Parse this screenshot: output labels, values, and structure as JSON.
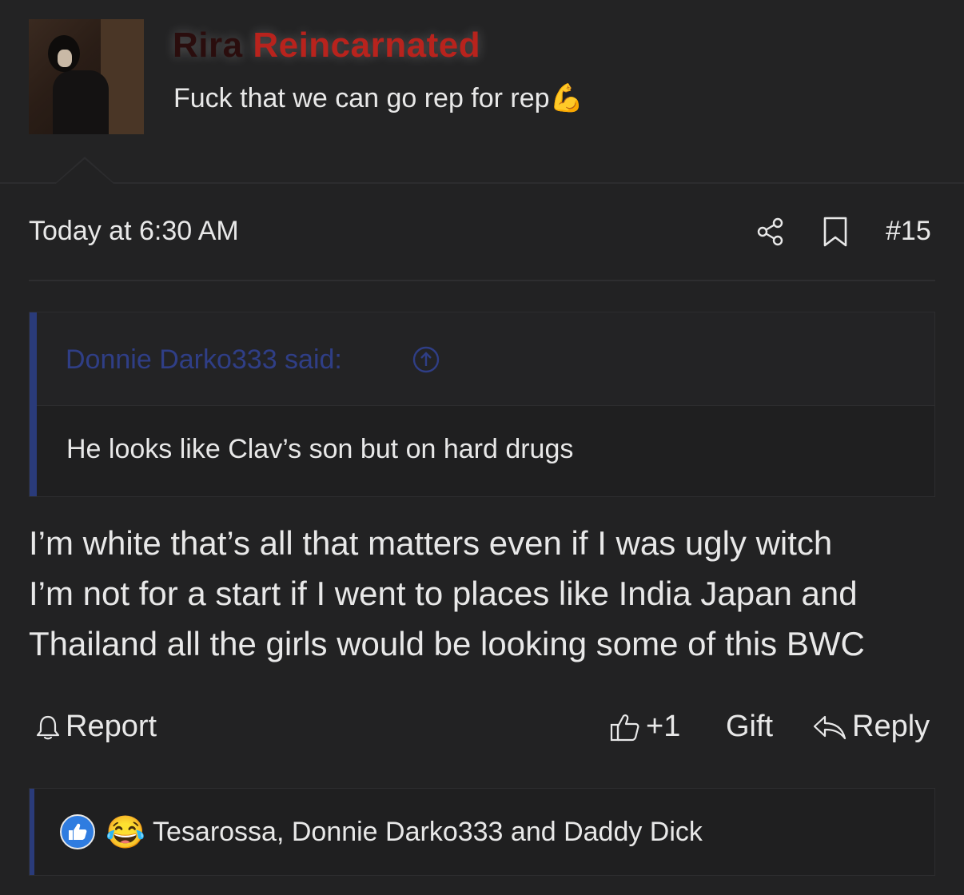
{
  "author": {
    "name_part1": "Rira",
    "name_part2": "Reincarnated",
    "custom_title": "Fuck that we can go rep for rep",
    "title_emoji": "💪"
  },
  "meta": {
    "timestamp": "Today at 6:30 AM",
    "post_number": "#15",
    "share_icon": "share-icon",
    "bookmark_icon": "bookmark-icon"
  },
  "quote": {
    "author_label": "Donnie Darko333 said:",
    "text": "He looks like Clav’s son but on hard drugs",
    "bar_color": "#2a3b7a",
    "author_color": "#2f3e86"
  },
  "post": {
    "line1": "I’m white that’s all that matters even if I was ugly witch",
    "line2": "I’m not for a start if I went to places like India Japan and",
    "line3": "Thailand all the girls would be looking some of this BWC"
  },
  "actions": {
    "report": "Report",
    "like": "+1",
    "gift": "Gift",
    "reply": "Reply"
  },
  "reactions": {
    "icons": [
      "like-icon",
      "laugh-cry-icon"
    ],
    "laugh_emoji": "😂",
    "users_text": "Tesarossa, Donnie Darko333 and Daddy Dick"
  },
  "colors": {
    "background": "#222223",
    "name_red": "#b8231d",
    "like_blue": "#2f7ce0"
  }
}
